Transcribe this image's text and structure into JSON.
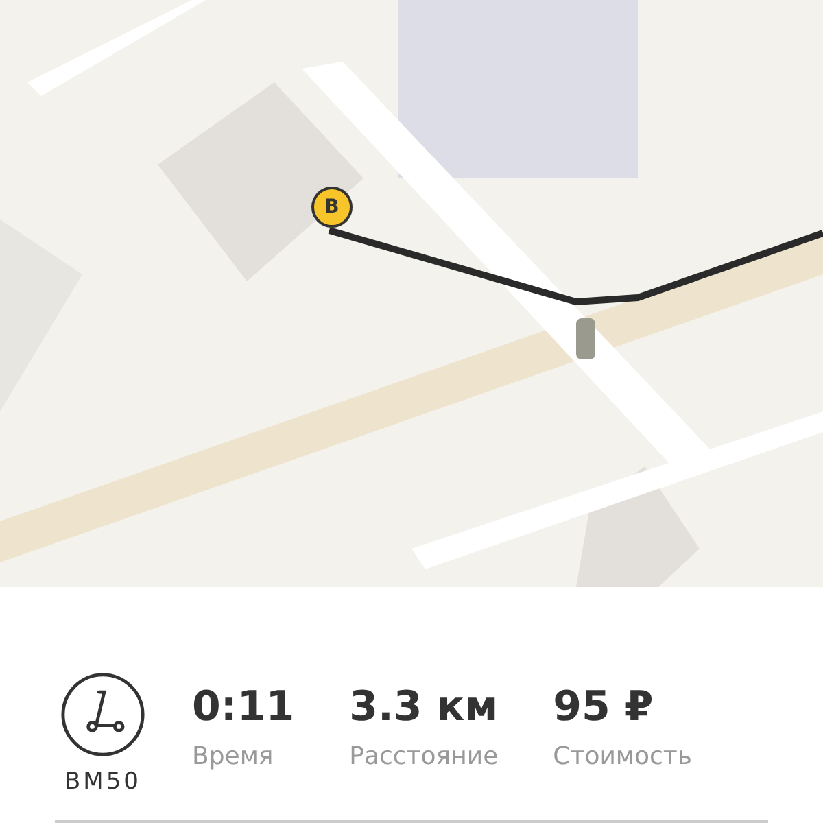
{
  "map": {
    "marker": {
      "label": "В"
    }
  },
  "vehicle": {
    "name": "BM50"
  },
  "stats": [
    {
      "value": "0:11",
      "label": "Время"
    },
    {
      "value": "3.3 км",
      "label": "Расстояние"
    },
    {
      "value": "95 ₽",
      "label": "Стоимость"
    }
  ]
}
